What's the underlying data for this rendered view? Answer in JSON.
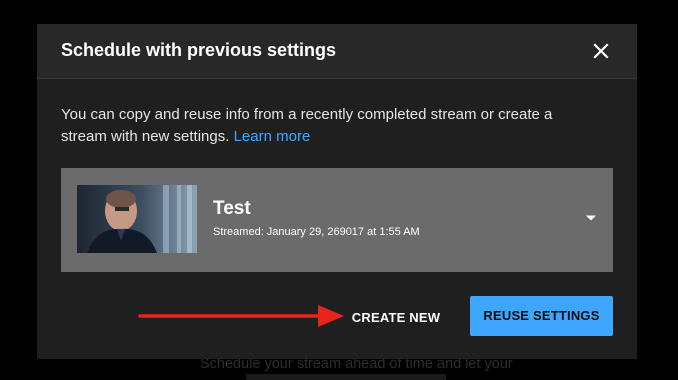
{
  "background": {
    "hint_text": "Schedule your stream ahead of time and let your"
  },
  "dialog": {
    "title": "Schedule with previous settings",
    "close_icon": "close-icon",
    "description": "You can copy and reuse info from a recently completed stream or create a stream with new settings.",
    "learn_more_label": "Learn more",
    "link_color": "#3ea6ff"
  },
  "stream": {
    "title": "Test",
    "meta": "Streamed: January 29, 269017 at 1:55 AM",
    "dropdown_icon": "dropdown-arrow-icon"
  },
  "actions": {
    "create_new_label": "CREATE NEW",
    "reuse_label": "REUSE SETTINGS",
    "reuse_color": "#3ea6ff"
  },
  "annotation": {
    "arrow_color": "#e8251a"
  }
}
